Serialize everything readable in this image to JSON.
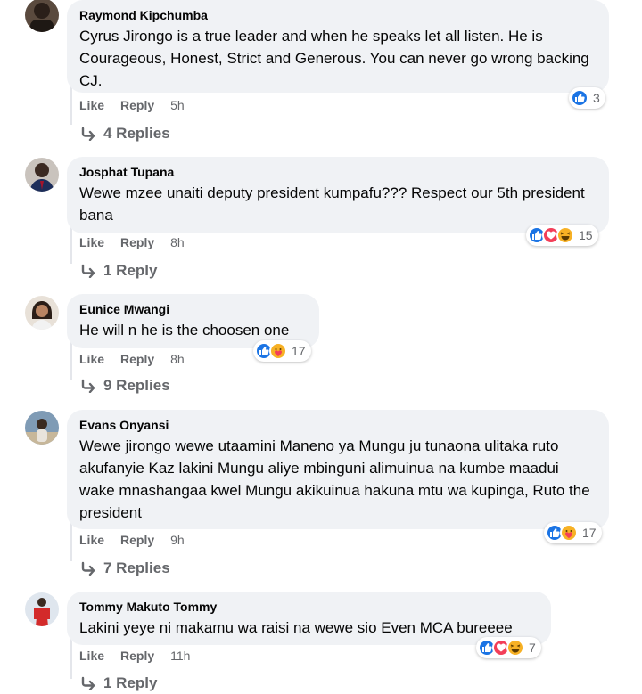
{
  "comments": [
    {
      "author": "Raymond Kipchumba",
      "text": "Cyrus Jirongo is a true leader and when he speaks let all listen. He is Courageous, Honest, Strict and Generous. You can never go wrong backing CJ.",
      "reactions": [
        "like-icon"
      ],
      "reaction_count": "3",
      "like_label": "Like",
      "reply_label": "Reply",
      "time": "5h",
      "replies_label": "4 Replies"
    },
    {
      "author": "Josphat Tupana",
      "text": "Wewe mzee unaiti deputy president kumpafu??? Respect our 5th president bana",
      "reactions": [
        "like-icon",
        "love-icon",
        "haha-icon"
      ],
      "reaction_count": "15",
      "like_label": "Like",
      "reply_label": "Reply",
      "time": "8h",
      "replies_label": "1 Reply"
    },
    {
      "author": "Eunice Mwangi",
      "text": "He will n he is the choosen one",
      "reactions": [
        "like-icon",
        "care-icon"
      ],
      "reaction_count": "17",
      "like_label": "Like",
      "reply_label": "Reply",
      "time": "8h",
      "replies_label": "9 Replies"
    },
    {
      "author": "Evans Onyansi",
      "text": "Wewe jirongo wewe utaamini Maneno ya Mungu ju tunaona ulitaka ruto akufanyie Kaz lakini Mungu aliye mbinguni alimuinua na kumbe maadui wake mnashangaa kwel Mungu akikuinua hakuna mtu wa kupinga, Ruto the president",
      "reactions": [
        "like-icon",
        "care-icon"
      ],
      "reaction_count": "17",
      "like_label": "Like",
      "reply_label": "Reply",
      "time": "9h",
      "replies_label": "7 Replies"
    },
    {
      "author": "Tommy Makuto Tommy",
      "text": "Lakini yeye ni makamu wa raisi na wewe sio Even MCA bureeee",
      "reactions": [
        "like-icon",
        "love-icon",
        "haha-icon"
      ],
      "reaction_count": "7",
      "like_label": "Like",
      "reply_label": "Reply",
      "time": "11h",
      "replies_label": "1 Reply"
    }
  ],
  "colors": {
    "bubble": "#f0f2f5",
    "secondary_text": "#65676b",
    "like_blue": "#1b74e4",
    "love_red": "#f33e58",
    "haha_yellow": "#f7b125"
  }
}
